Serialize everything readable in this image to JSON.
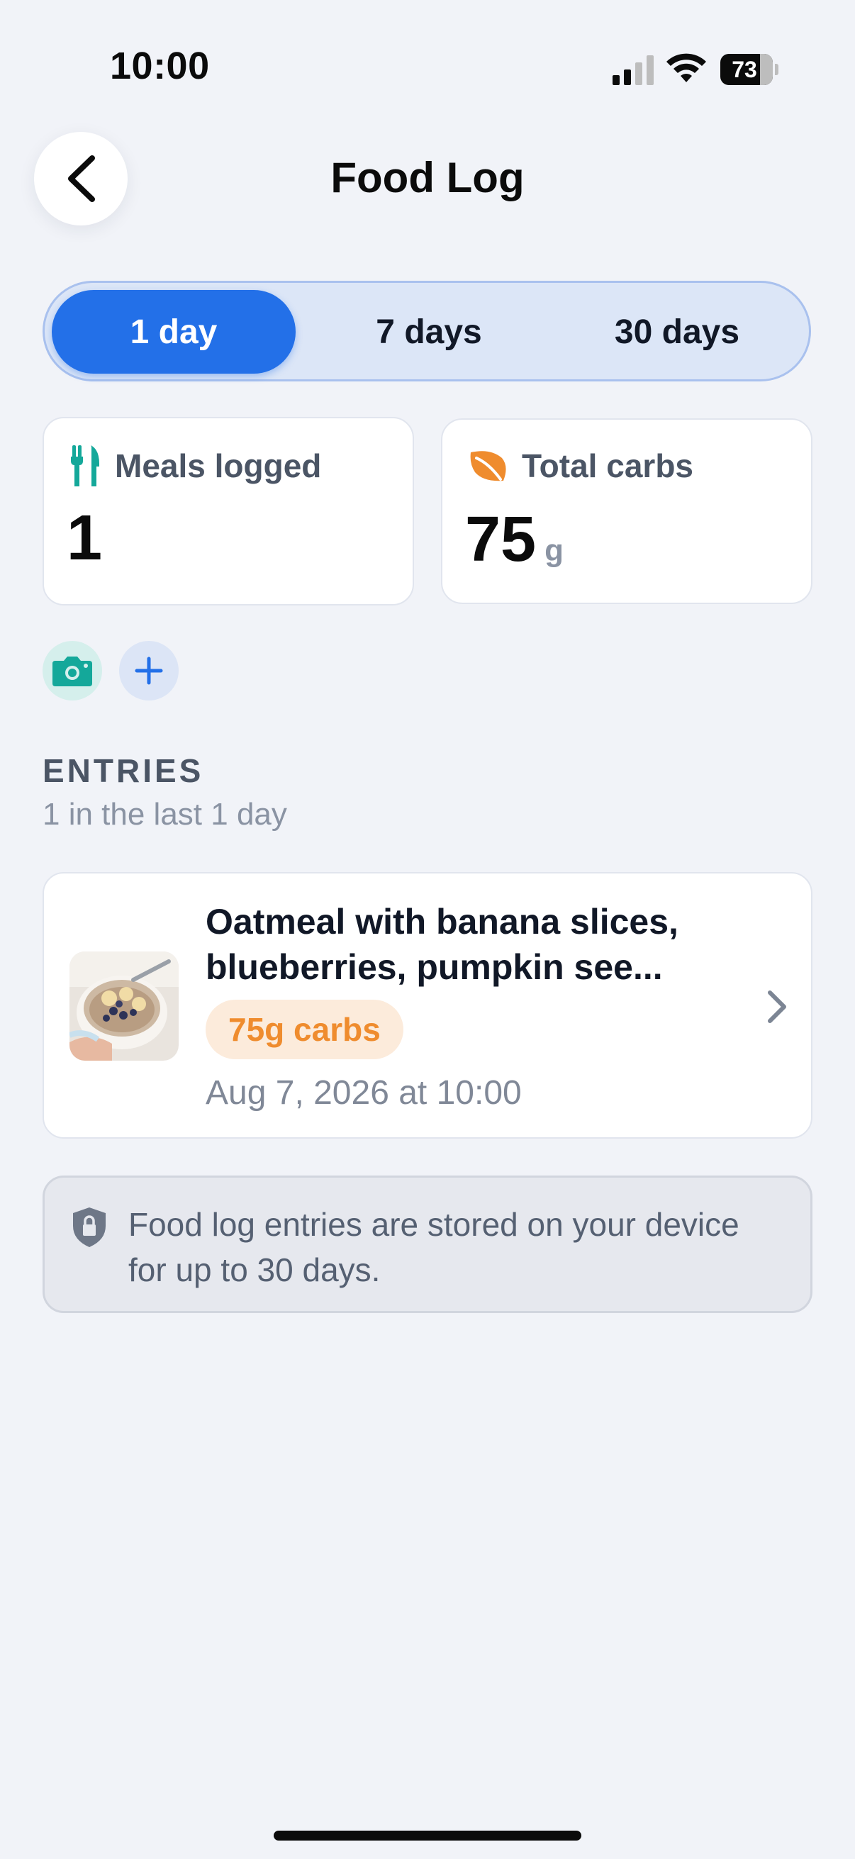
{
  "status_bar": {
    "time": "10:00",
    "battery_level": "73"
  },
  "header": {
    "title": "Food Log",
    "back_icon": "chevron-left-icon"
  },
  "range_tabs": [
    {
      "label": "1 day",
      "selected": true
    },
    {
      "label": "7 days",
      "selected": false
    },
    {
      "label": "30 days",
      "selected": false
    }
  ],
  "stats": {
    "meals": {
      "label": "Meals logged",
      "value": "1",
      "icon": "fork-knife-icon",
      "icon_color": "#14A89A"
    },
    "carbs": {
      "label": "Total carbs",
      "value": "75",
      "unit": "g",
      "icon": "leaf-icon",
      "icon_color": "#EF8C2E"
    }
  },
  "actions": [
    {
      "name": "camera",
      "icon": "camera-icon",
      "color": "#14A89A"
    },
    {
      "name": "add",
      "icon": "plus-icon",
      "color": "#2370E8"
    }
  ],
  "entries_section": {
    "title": "ENTRIES",
    "subtitle": "1 in the last 1 day",
    "items": [
      {
        "title": "Oatmeal with banana slices, blueberries, pumpkin see...",
        "carbs_badge": "75g carbs",
        "timestamp": "Aug 7, 2026 at 10:00",
        "thumbnail": "oatmeal bowl photo"
      }
    ]
  },
  "info": {
    "icon": "lock-shield-icon",
    "text": "Food log entries are stored on your device for up to 30 days."
  },
  "colors": {
    "accent": "#2370E8",
    "background": "#F1F3F8",
    "badge_text": "#EF8C2E",
    "badge_bg": "#FCEBDB"
  }
}
